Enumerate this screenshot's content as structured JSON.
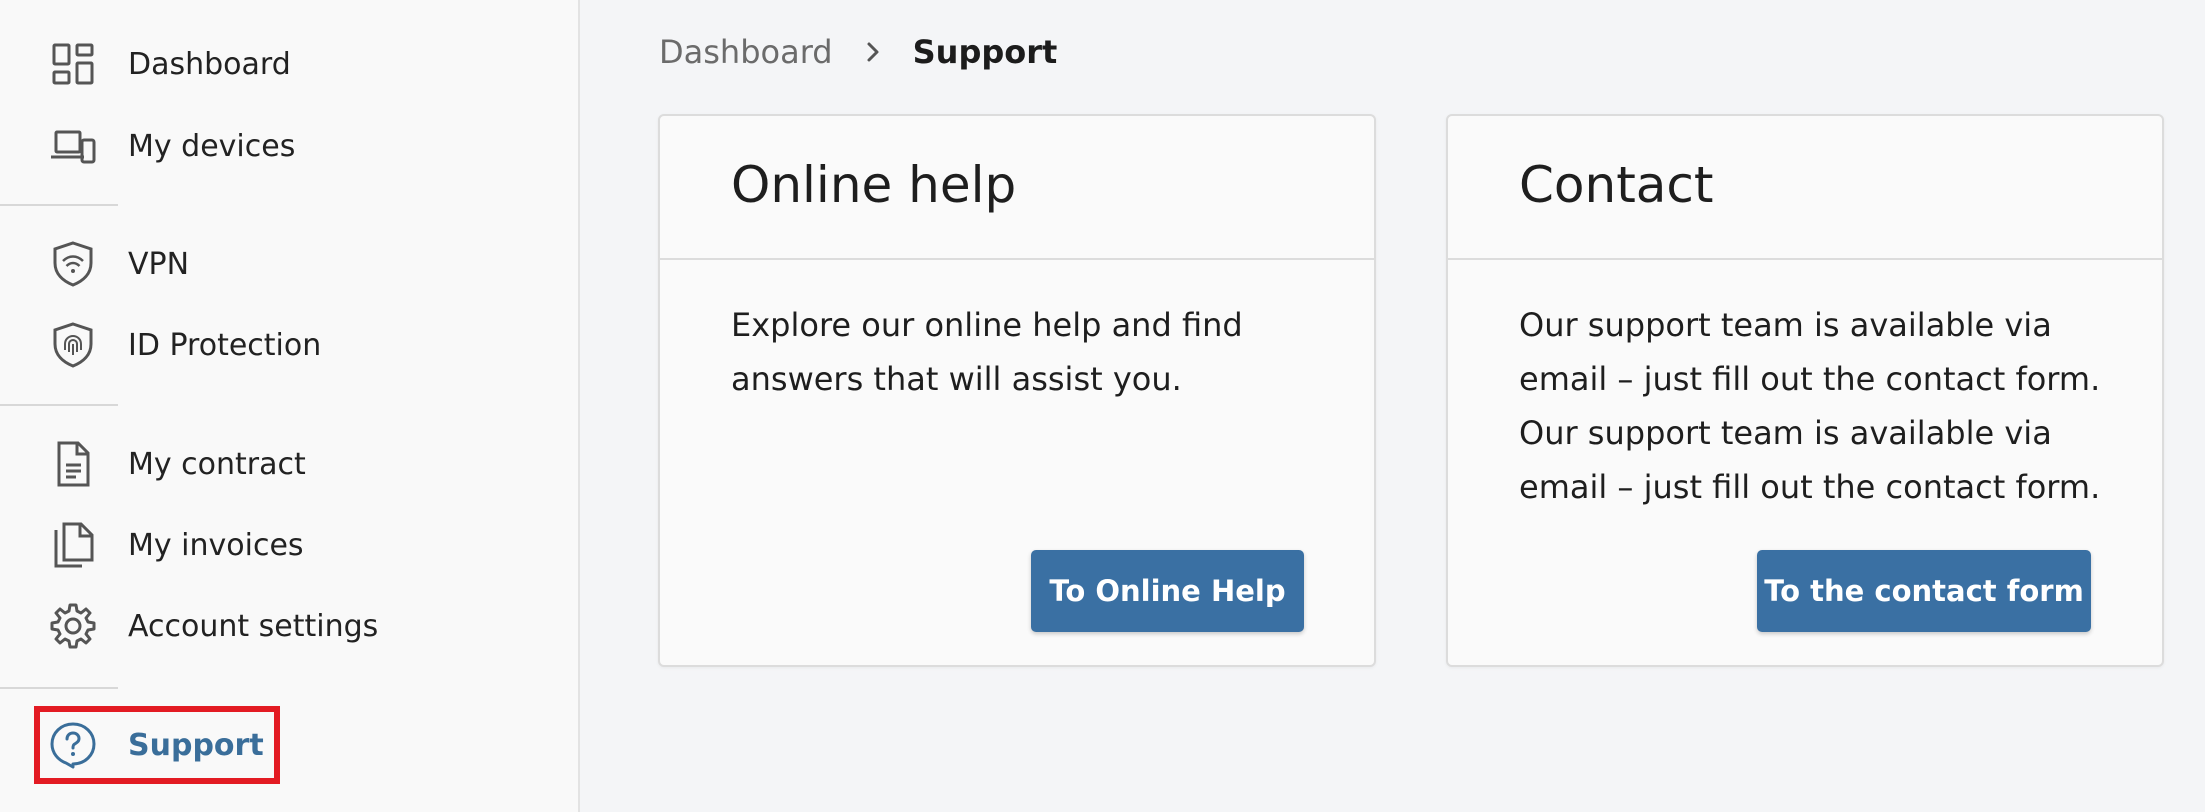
{
  "sidebar": {
    "items": [
      {
        "label": "Dashboard",
        "icon": "dashboard-icon"
      },
      {
        "label": "My devices",
        "icon": "devices-icon"
      },
      {
        "label": "VPN",
        "icon": "vpn-shield-icon"
      },
      {
        "label": "ID Protection",
        "icon": "id-protection-shield-icon"
      },
      {
        "label": "My contract",
        "icon": "document-icon"
      },
      {
        "label": "My invoices",
        "icon": "copy-documents-icon"
      },
      {
        "label": "Account settings",
        "icon": "gear-icon"
      },
      {
        "label": "Support",
        "icon": "help-question-icon",
        "active": true
      }
    ]
  },
  "breadcrumb": {
    "parent": "Dashboard",
    "current": "Support"
  },
  "cards": {
    "online_help": {
      "title": "Online help",
      "text": "Explore our online help and find answers that will assist you.",
      "button": "To Online Help"
    },
    "contact": {
      "title": "Contact",
      "lines": [
        "Our support team is available via email – just fill out the contact form.",
        "Our support team is available via email – just fill out the contact form."
      ],
      "button": "To the contact form"
    }
  },
  "colors": {
    "accent": "#3a70a3",
    "active_text": "#3a6e9a",
    "highlight": "#e31b23",
    "page_bg": "#f4f5f7"
  }
}
